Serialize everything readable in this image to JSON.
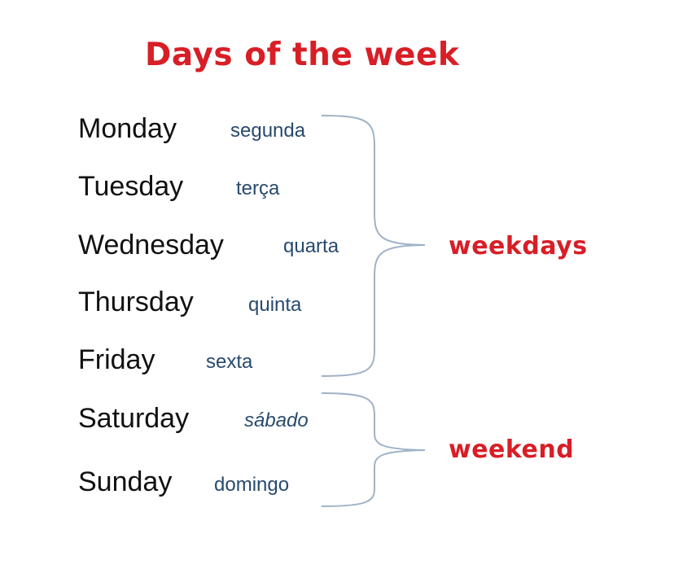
{
  "title": "Days of the week",
  "days": [
    {
      "english": "Monday",
      "portuguese": "segunda"
    },
    {
      "english": "Tuesday",
      "portuguese": "terça"
    },
    {
      "english": "Wednesday",
      "portuguese": "quarta"
    },
    {
      "english": "Thursday",
      "portuguese": "quinta"
    },
    {
      "english": "Friday",
      "portuguese": "sexta"
    },
    {
      "english": "Saturday",
      "portuguese": "sábado"
    },
    {
      "english": "Sunday",
      "portuguese": "domingo"
    }
  ],
  "groups": {
    "weekdays": "weekdays",
    "weekend": "weekend"
  },
  "colors": {
    "title": "#d81e26",
    "english": "#111111",
    "portuguese": "#284a6e",
    "brace": "#9fb3c8"
  }
}
